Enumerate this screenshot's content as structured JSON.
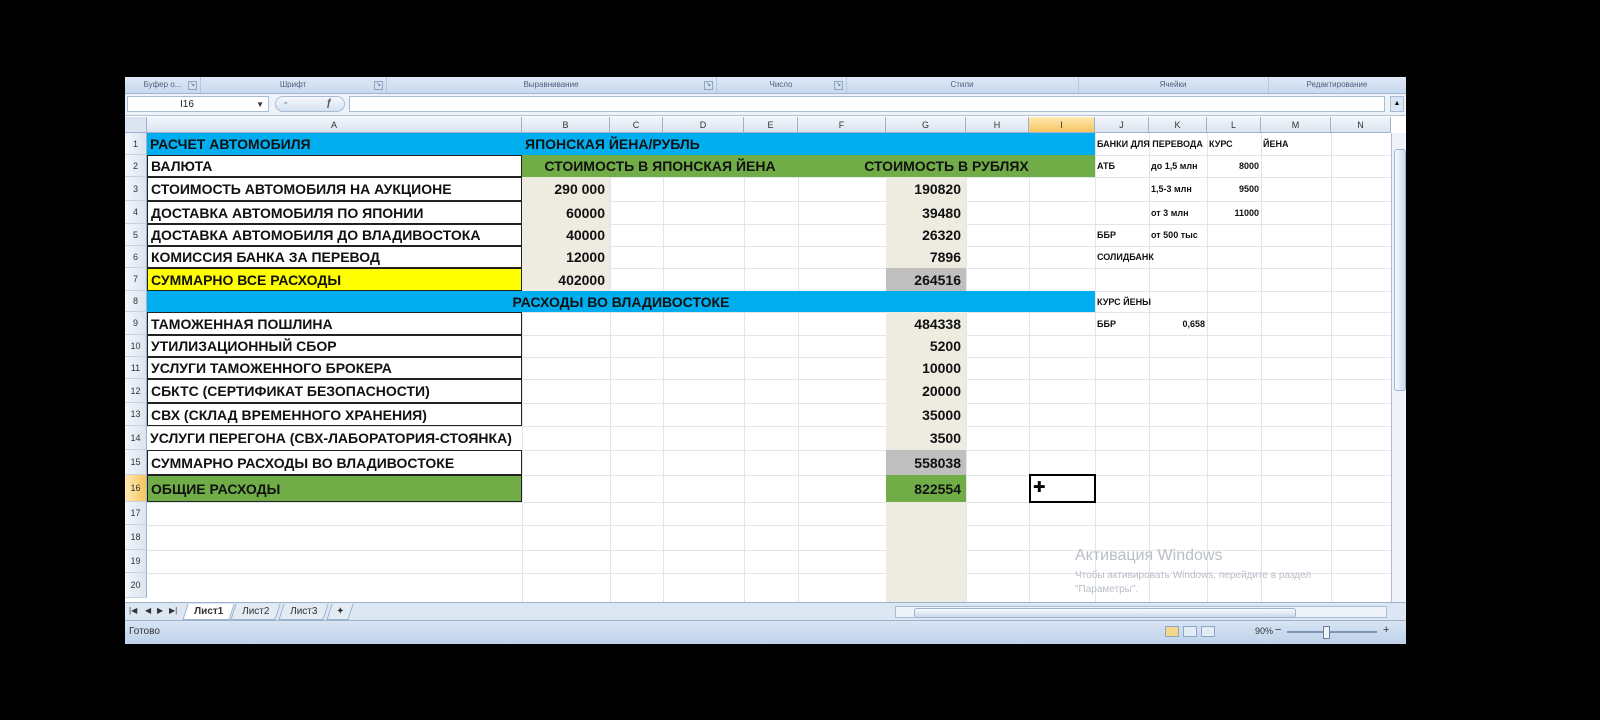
{
  "ribbon": {
    "groups": [
      "Буфер о...",
      "Шрифт",
      "Выравнивание",
      "Число",
      "Стили",
      "Ячейки",
      "Редактирование"
    ]
  },
  "formula_bar": {
    "name_box": "I16",
    "value": ""
  },
  "columns": [
    "A",
    "B",
    "C",
    "D",
    "E",
    "F",
    "G",
    "H",
    "I",
    "J",
    "K",
    "L",
    "M",
    "N"
  ],
  "selected_column": "I",
  "rows": [
    "1",
    "2",
    "3",
    "4",
    "5",
    "6",
    "7",
    "8",
    "9",
    "10",
    "11",
    "12",
    "13",
    "14",
    "15",
    "16",
    "17",
    "18",
    "19",
    "20"
  ],
  "selected_row": "16",
  "sheet": {
    "a1": "РАСЧЕТ АВТОМОБИЛЯ",
    "b1": "ЯПОНСКАЯ ЙЕНА/РУБЛЬ",
    "a2": "ВАЛЮТА",
    "b2": "СТОИМОСТЬ В ЯПОНСКАЯ ЙЕНА",
    "f2": "СТОИМОСТЬ В РУБЛЯХ",
    "a3": "СТОИМОСТЬ АВТОМОБИЛЯ НА АУКЦИОНЕ",
    "b3": "290 000",
    "g3": "190820",
    "a4": "ДОСТАВКА АВТОМОБИЛЯ ПО ЯПОНИИ",
    "b4": "60000",
    "g4": "39480",
    "a5": "ДОСТАВКА АВТОМОБИЛЯ ДО ВЛАДИВОСТОКА",
    "b5": "40000",
    "g5": "26320",
    "a6": "КОМИССИЯ БАНКА ЗА ПЕРЕВОД",
    "b6": "12000",
    "g6": "7896",
    "a7": "СУММАРНО ВСЕ РАСХОДЫ",
    "b7": "402000",
    "g7": "264516",
    "a8": "РАСХОДЫ ВО ВЛАДИВОСТОКЕ",
    "a9": "ТАМОЖЕННАЯ ПОШЛИНА",
    "g9": "484338",
    "a10": "УТИЛИЗАЦИОННЫЙ СБОР",
    "g10": "5200",
    "a11": "УСЛУГИ ТАМОЖЕННОГО БРОКЕРА",
    "g11": "10000",
    "a12": "СБКТС (СЕРТИФИКАТ БЕЗОПАСНОСТИ)",
    "g12": "20000",
    "a13": "СВХ (СКЛАД ВРЕМЕННОГО ХРАНЕНИЯ)",
    "g13": "35000",
    "a14": "УСЛУГИ ПЕРЕГОНА (СВХ-ЛАБОРАТОРИЯ-СТОЯНКА)",
    "g14": "3500",
    "a15": "СУММАРНО РАСХОДЫ ВО ВЛАДИВОСТОКЕ",
    "g15": "558038",
    "a16": "ОБЩИЕ РАСХОДЫ",
    "g16": "822554",
    "j1": "БАНКИ ДЛЯ ПЕРЕВОДА",
    "l1": "КУРС",
    "m1": "ЙЕНА",
    "j2": "АТБ",
    "k2": "до 1,5 млн",
    "l2": "8000",
    "k3": "1,5-3 млн",
    "l3": "9500",
    "k4": "от 3 млн",
    "l4": "11000",
    "j5": "ББР",
    "k5": "от 500 тыс",
    "j6": "СОЛИДБАНК",
    "j8": "КУРС ЙЕНЫ",
    "j9": "ББР",
    "k9": "0,658"
  },
  "sheet_tabs": [
    "Лист1",
    "Лист2",
    "Лист3"
  ],
  "active_tab": "Лист1",
  "status": {
    "text": "Готово",
    "zoom": "90%"
  },
  "watermark": {
    "title": "Активация Windows",
    "text": "Чтобы активировать Windows, перейдите в раздел \"Параметры\"."
  },
  "colors": {
    "blue_header": "#00aeef",
    "green_header": "#70ad47",
    "yellow_total": "#ffff00",
    "gray_total": "#bfbfbf",
    "tan_column": "#eeece1"
  }
}
